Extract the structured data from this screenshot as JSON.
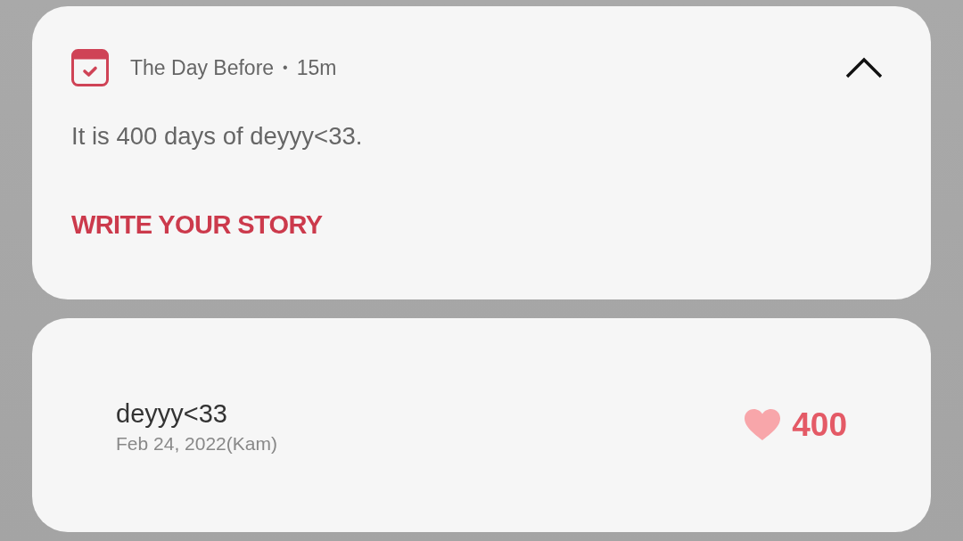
{
  "notification": {
    "app_name": "The Day Before",
    "separator": "•",
    "time": "15m",
    "expanded": true,
    "message": "It is 400 days of deyyy<33.",
    "action": "WRITE YOUR STORY"
  },
  "widget": {
    "title": "deyyy<33",
    "date": "Feb 24, 2022(Kam)",
    "count": "400"
  }
}
